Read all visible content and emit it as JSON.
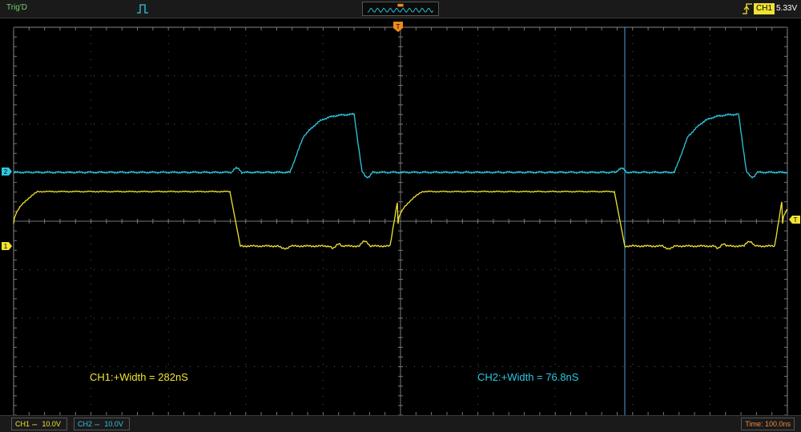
{
  "colors": {
    "ch1": "#f0e432",
    "ch2": "#2ec8e0",
    "cursor": "#4aa3df",
    "trigger_marker": "#f08a1c",
    "grid": "#555555",
    "time_label": "#f08a3c"
  },
  "topbar": {
    "trig_status": "Trig'D",
    "trigger_icon": "pulse-icon",
    "overview_icon": "waveform-overview-icon",
    "edge_icon": "rising-edge-icon",
    "trigger_source": "CH1",
    "trigger_level": "5.33V"
  },
  "screen": {
    "trigger_position_marker": "T",
    "trigger_level_marker": "T",
    "ch1_marker": "1",
    "ch2_marker": "2"
  },
  "measurements": {
    "ch1": "CH1:+Width = 282nS",
    "ch2": "CH2:+Width = 76.8nS"
  },
  "bottombar": {
    "ch1": {
      "label": "CH1",
      "coupling_icon": "dc-coupling-icon",
      "volts_div": "10.0V"
    },
    "ch2": {
      "label": "CH2",
      "coupling_icon": "dc-coupling-icon",
      "volts_div": "10.0V"
    },
    "time_div": "Time: 100.0ns"
  }
}
